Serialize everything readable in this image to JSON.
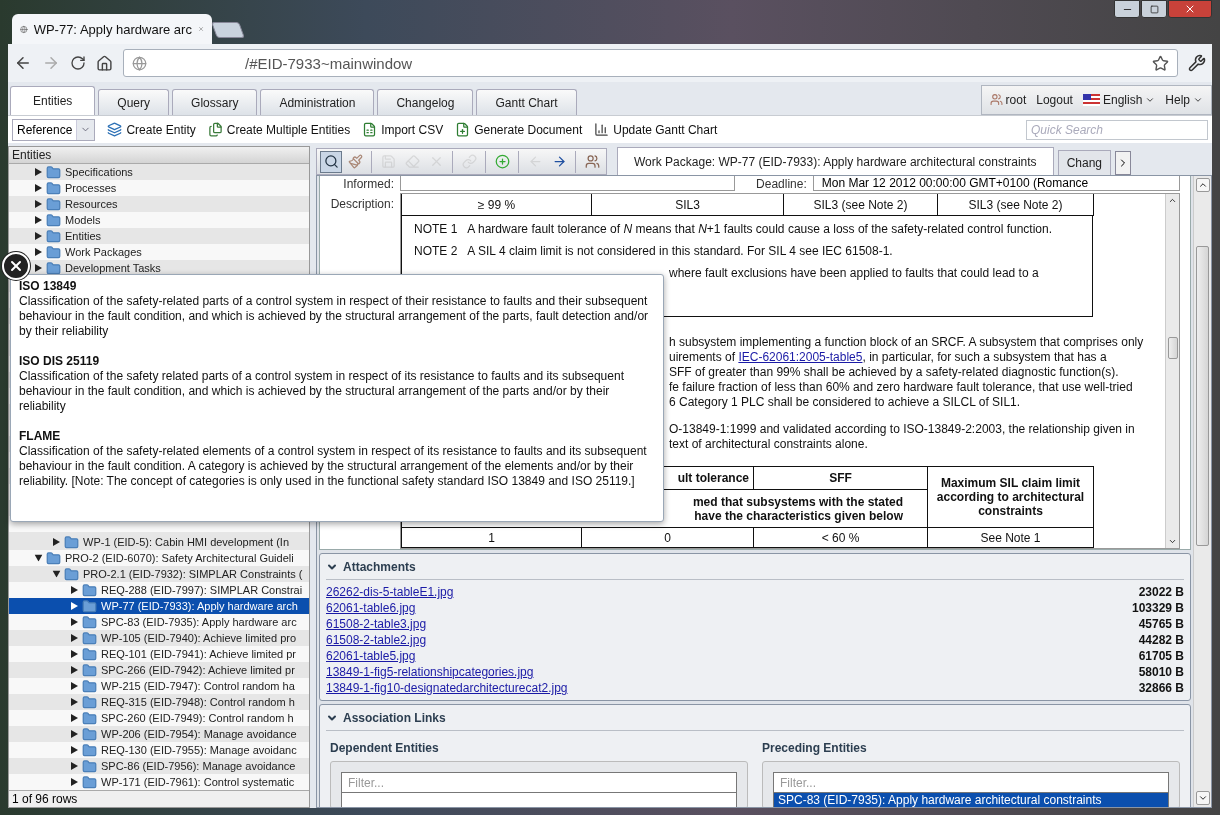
{
  "browser": {
    "tab_title": "WP-77: Apply hardware arc",
    "address": "/#EID-7933~mainwindow"
  },
  "app_tabs": [
    {
      "label": "Entities",
      "selected": true
    },
    {
      "label": "Query",
      "selected": false
    },
    {
      "label": "Glossary",
      "selected": false
    },
    {
      "label": "Administration",
      "selected": false
    },
    {
      "label": "Changelog",
      "selected": false
    },
    {
      "label": "Gantt Chart",
      "selected": false
    }
  ],
  "user_menu": {
    "user": "root",
    "logout": "Logout",
    "language": "English",
    "help": "Help"
  },
  "toolbar": {
    "type_select": "Reference",
    "actions": [
      "Create Entity",
      "Create Multiple Entities",
      "Import CSV",
      "Generate Document",
      "Update Gantt Chart"
    ],
    "quick_search": {
      "placeholder": "Quick Search"
    }
  },
  "entity_tree": {
    "title": "Entities",
    "top_items": [
      {
        "label": "Specifications",
        "expanded": false,
        "selected": false
      },
      {
        "label": "Processes",
        "expanded": false,
        "selected": false
      },
      {
        "label": "Resources",
        "expanded": false,
        "selected": false
      },
      {
        "label": "Models",
        "expanded": false,
        "selected": false
      },
      {
        "label": "Entities",
        "expanded": false,
        "selected": false
      },
      {
        "label": "Work Packages",
        "expanded": false,
        "selected": false
      },
      {
        "label": "Development Tasks",
        "expanded": false,
        "selected": false
      }
    ],
    "continued_children": [
      {
        "label": "WP-1 (EID-5): Cabin HMI development (In",
        "expanded": false,
        "selected": false
      }
    ],
    "lower_items": [
      {
        "label": "PRO-2 (EID-6070): Safety Architectural Guideli",
        "expanded": true,
        "selected": false,
        "children": [
          {
            "label": "PRO-2.1 (EID-7932): SIMPLAR Constraints (",
            "expanded": true,
            "selected": false,
            "children": [
              {
                "label": "REQ-288 (EID-7997): SIMPLAR Constrai",
                "expanded": false,
                "selected": false
              },
              {
                "label": "WP-77 (EID-7933): Apply hardware arch",
                "expanded": false,
                "selected": true
              },
              {
                "label": "SPC-83 (EID-7935): Apply hardware arc",
                "expanded": false,
                "selected": false
              },
              {
                "label": "WP-105 (EID-7940): Achieve limited pro",
                "expanded": false,
                "selected": false
              },
              {
                "label": "REQ-101 (EID-7941): Achieve limited pr",
                "expanded": false,
                "selected": false
              },
              {
                "label": "SPC-266 (EID-7942): Achieve limited pr",
                "expanded": false,
                "selected": false
              },
              {
                "label": "WP-215 (EID-7947): Control random ha",
                "expanded": false,
                "selected": false
              },
              {
                "label": "REQ-315 (EID-7948): Control random h",
                "expanded": false,
                "selected": false
              },
              {
                "label": "SPC-260 (EID-7949): Control random h",
                "expanded": false,
                "selected": false
              },
              {
                "label": "WP-206 (EID-7954): Manage avoidance",
                "expanded": false,
                "selected": false
              },
              {
                "label": "REQ-130 (EID-7955): Manage avoidanc",
                "expanded": false,
                "selected": false
              },
              {
                "label": "SPC-86 (EID-7956): Manage avoidance",
                "expanded": false,
                "selected": false
              },
              {
                "label": "WP-171 (EID-7961): Control systematic",
                "expanded": false,
                "selected": false
              }
            ]
          }
        ]
      }
    ],
    "footer": "1 of 96 rows"
  },
  "entity_tools": [
    {
      "pressed": true,
      "disabled": false
    },
    {
      "pressed": false,
      "disabled": false
    },
    {
      "pressed": false,
      "disabled": true
    },
    {
      "pressed": false,
      "disabled": true
    },
    {
      "pressed": false,
      "disabled": true
    },
    {
      "pressed": false,
      "disabled": true
    },
    {
      "pressed": false,
      "disabled": false
    },
    {
      "pressed": false,
      "disabled": true
    },
    {
      "pressed": false,
      "disabled": false
    },
    {
      "pressed": false,
      "disabled": false
    }
  ],
  "detail_tabs": [
    {
      "label": "Work Package: WP-77 (EID-7933): Apply hardware architectural constraints",
      "selected": true
    },
    {
      "label": "Chang",
      "selected": false
    }
  ],
  "fields": {
    "informed_label": "Informed:",
    "deadline_label": "Deadline:",
    "deadline_value": "Mon Mar 12 2012 00:00:00 GMT+0100 (Romance",
    "description_label": "Description:"
  },
  "description": {
    "sil_row": [
      "≥ 99 %",
      "SIL3",
      "SIL3 (see Note 2)",
      "SIL3 (see Note 2)"
    ],
    "notes": [
      {
        "label": "NOTE 1",
        "text": "A hardware fault tolerance of *N* means that *N*+1 faults could cause a loss of the safety-related control function."
      },
      {
        "label": "NOTE 2",
        "text": "A SIL 4 claim limit is not considered in this standard. For SIL 4 see IEC 61508-1."
      }
    ],
    "note_fragment": "where fault exclusions have been applied to faults that could lead to a",
    "paragraph_lines": [
      {
        "kind": "text",
        "text": "h subsystem implementing a function block of an SRCF. A subsystem that comprises only"
      },
      {
        "kind": "link",
        "before": "uirements of ",
        "link": "IEC-62061:2005-table5",
        "after": ", in particular, for such a subsystem that has a"
      },
      {
        "kind": "text",
        "text": "SFF of greater than 99% shall be achieved by a safety-related diagnostic function(s)."
      },
      {
        "kind": "text",
        "text": "fe failure fraction of less than 60% and zero hardware fault tolerance, that use well-tried"
      },
      {
        "kind": "text",
        "text": "6 Category 1 PLC shall be considered to achieve a SILCL of SIL1."
      }
    ],
    "paragraph2_lines": [
      {
        "kind": "text",
        "text": "O-13849-1:1999 and validated according to ISO-13849-2:2003, the relationship given in"
      },
      {
        "kind": "text",
        "text": "text of architectural constraints alone."
      }
    ],
    "constraint_table": {
      "headers": [
        "ult tolerance",
        "SFF",
        "Maximum SIL claim limit according to architectural constraints"
      ],
      "subheader": [
        "med that subsystems with the stated",
        "have the characteristics given below"
      ],
      "row": [
        "1",
        "0",
        "< 60 %",
        "See Note 1"
      ]
    }
  },
  "attachments": {
    "title": "Attachments",
    "expanded": true,
    "files": [
      {
        "name": "26262-dis-5-tableE1.jpg",
        "size": "23022 B"
      },
      {
        "name": "62061-table6.jpg",
        "size": "103329 B"
      },
      {
        "name": "61508-2-table3.jpg",
        "size": "45765 B"
      },
      {
        "name": "61508-2-table2.jpg",
        "size": "44282 B"
      },
      {
        "name": "62061-table5.jpg",
        "size": "61705 B"
      },
      {
        "name": "13849-1-fig5-relationshipcategories.jpg",
        "size": "58010 B"
      },
      {
        "name": "13849-1-fig10-designatedarchitecturecat2.jpg",
        "size": "32866 B"
      }
    ]
  },
  "association_links": {
    "title": "Association Links",
    "expanded": true,
    "dependent": {
      "title": "Dependent Entities",
      "placeholder": "Filter..."
    },
    "preceding": {
      "title": "Preceding Entities",
      "placeholder": "Filter...",
      "items": [
        {
          "label": "SPC-83 (EID-7935): Apply hardware architectural constraints",
          "selected": true
        }
      ]
    }
  },
  "glossary_popup": {
    "entries": [
      {
        "term": "ISO 13849",
        "definition": "Classification of the safety-related parts of a control system in respect of their resistance to faults and their subsequent behaviour in the fault condition, and which is achieved by the structural arrangement of the parts, fault detection and/or by their reliability"
      },
      {
        "term": "ISO DIS 25119",
        "definition": "Classification of the safety related parts of a control system in respect of its resistance to faults and its subsequent behaviour in the fault condition, and which is achieved by the structural arrangement of the parts and/or by their reliability"
      },
      {
        "term": "FLAME",
        "definition": "Classification of the safety-related elements of a control system in respect of its resistance to faults and its subsequent behaviour in the fault condition. A category is achieved by the structural arrangement of the elements and/or by their reliability. [Note: The concept of categories is only used in the functional safety standard ISO 13849 and ISO 25119.]"
      }
    ]
  }
}
